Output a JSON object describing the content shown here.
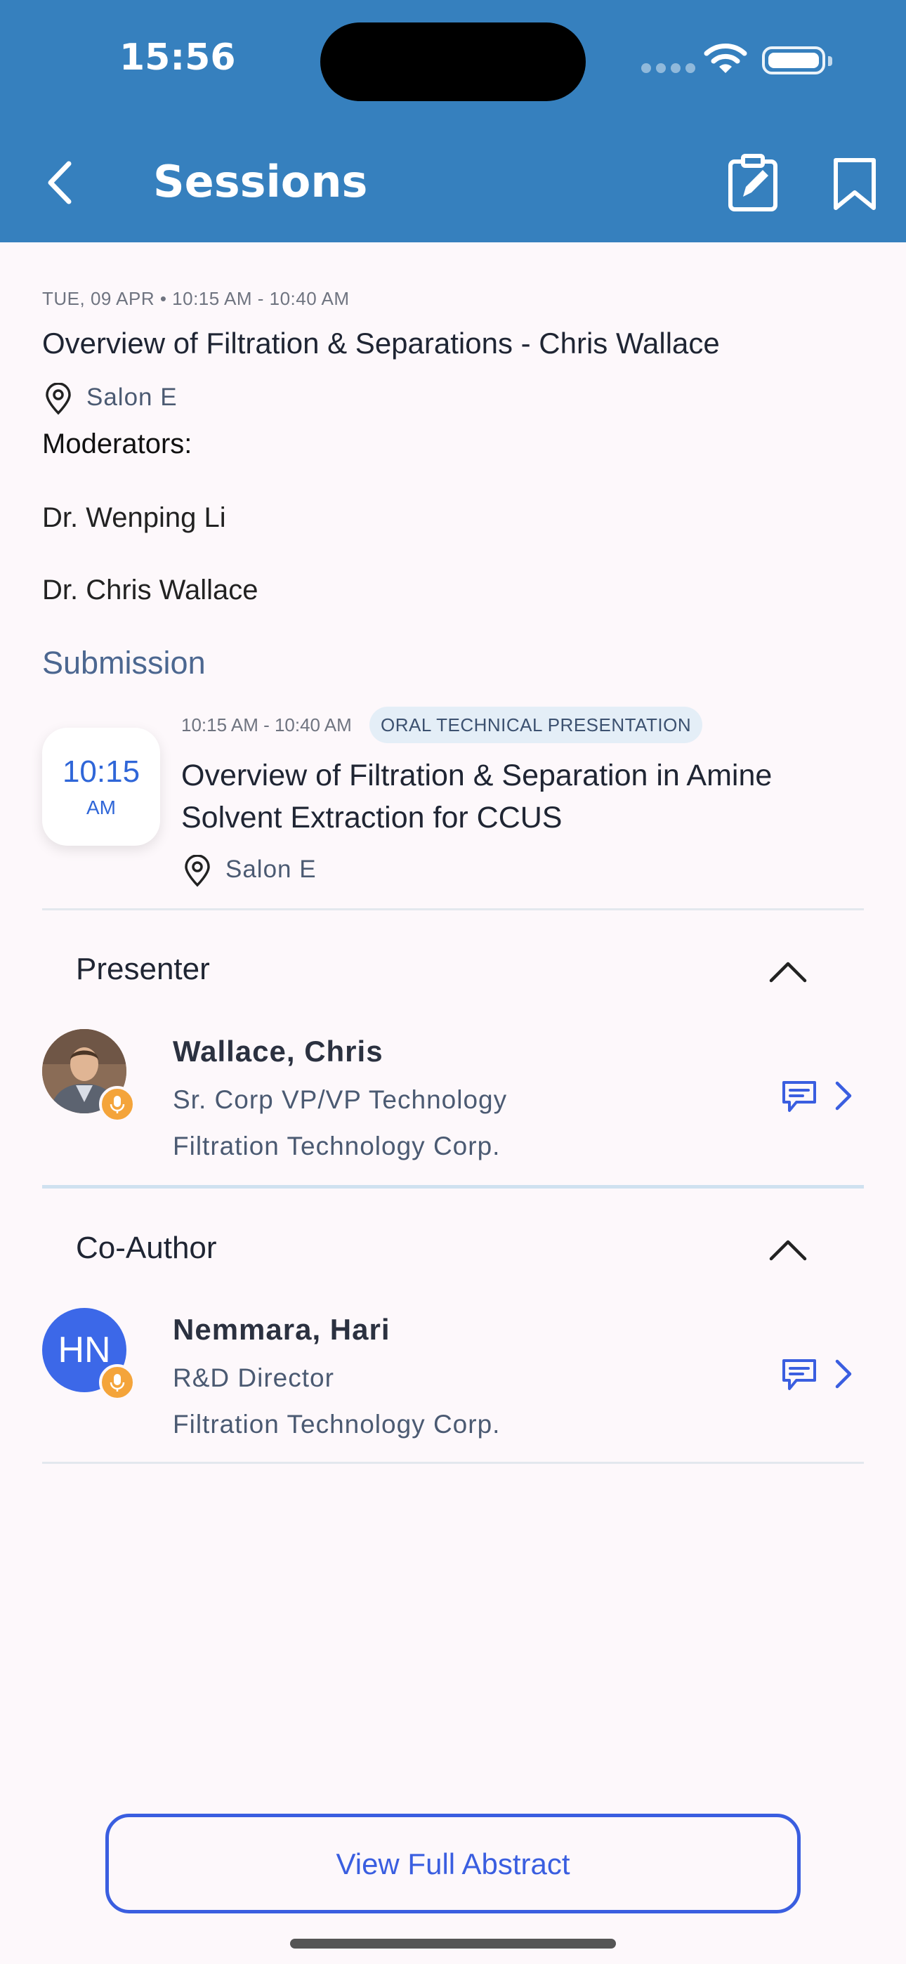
{
  "status": {
    "time": "15:56"
  },
  "header": {
    "title": "Sessions"
  },
  "session": {
    "date_line": "TUE, 09 APR • 10:15 AM - 10:40 AM",
    "title": "Overview of Filtration & Separations - Chris Wallace",
    "location": "Salon E",
    "moderators_label": "Moderators:",
    "moderators": [
      "Dr. Wenping Li",
      "Dr. Chris Wallace"
    ]
  },
  "submission": {
    "heading": "Submission",
    "card_time": "10:15",
    "card_ampm": "AM",
    "time_range": "10:15 AM - 10:40 AM",
    "badge": "ORAL TECHNICAL PRESENTATION",
    "title_line1": "Overview of Filtration & Separation in Amine",
    "title_line2": "Solvent Extraction for CCUS",
    "location": "Salon E"
  },
  "presenter": {
    "heading": "Presenter",
    "name": "Wallace, Chris",
    "role": "Sr. Corp VP/VP Technology",
    "org": "Filtration Technology Corp."
  },
  "coauthor": {
    "heading": "Co-Author",
    "initials": "HN",
    "name": "Nemmara, Hari",
    "role": "R&D Director",
    "org": "Filtration Technology Corp."
  },
  "actions": {
    "view_abstract": "View Full Abstract"
  },
  "colors": {
    "header": "#3680be",
    "accent": "#3a5ee0",
    "mic_badge": "#f4a43a",
    "avatar_bg": "#3c68e8"
  }
}
